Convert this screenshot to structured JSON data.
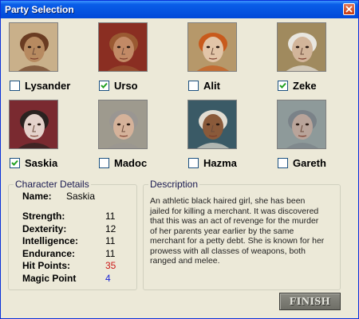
{
  "window": {
    "title": "Party Selection"
  },
  "characters": [
    {
      "name": "Lysander",
      "selected": false,
      "skin": "#b78a60",
      "hair": "#6a3c22",
      "bg": "#c9b08a"
    },
    {
      "name": "Urso",
      "selected": true,
      "skin": "#c28a66",
      "hair": "#9a5a32",
      "bg": "#8a2e22"
    },
    {
      "name": "Alit",
      "selected": false,
      "skin": "#e2c5a8",
      "hair": "#c85a1c",
      "bg": "#b6986a"
    },
    {
      "name": "Zeke",
      "selected": true,
      "skin": "#d2b59a",
      "hair": "#e8e6df",
      "bg": "#a08a5e"
    },
    {
      "name": "Saskia",
      "selected": true,
      "skin": "#e4d2cb",
      "hair": "#2a2220",
      "bg": "#7a2a30"
    },
    {
      "name": "Madoc",
      "selected": false,
      "skin": "#d5b29a",
      "hair": "#9a9692",
      "bg": "#9e9a8e"
    },
    {
      "name": "Hazma",
      "selected": false,
      "skin": "#8a5a3a",
      "hair": "#e2ddd2",
      "bg": "#3a5a66"
    },
    {
      "name": "Gareth",
      "selected": false,
      "skin": "#b9a49a",
      "hair": "#7a8288",
      "bg": "#8e9a9a"
    }
  ],
  "details": {
    "legend": "Character Details",
    "name_label": "Name:",
    "name_value": "Saskia",
    "stats": [
      {
        "label": "Strength:",
        "value": "11",
        "color": "#000000"
      },
      {
        "label": "Dexterity:",
        "value": "12",
        "color": "#000000"
      },
      {
        "label": "Intelligence:",
        "value": "11",
        "color": "#000000"
      },
      {
        "label": "Endurance:",
        "value": "11",
        "color": "#000000"
      },
      {
        "label": "Hit Points:",
        "value": "35",
        "color": "#cc1a1a"
      },
      {
        "label": "Magic Point",
        "value": "4",
        "color": "#1a24d6"
      }
    ]
  },
  "description": {
    "legend": "Description",
    "lines": [
      "An athletic black haired girl, she has been",
      "jailed for killing a merchant. It was discovered",
      "that this was an act of revenge for the murder",
      "of her parents year earlier by the same",
      "merchant for a petty debt. She is known for her",
      "prowess with all classes of weapons, both",
      "ranged and melee."
    ]
  },
  "finish_label": "FINISH"
}
